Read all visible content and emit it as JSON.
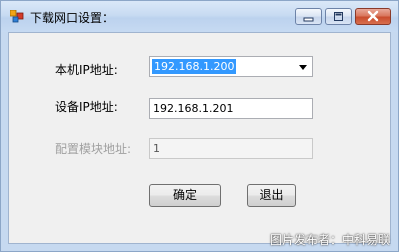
{
  "window": {
    "title": "下载网口设置："
  },
  "form": {
    "local_ip_label": "本机IP地址:",
    "local_ip_value": "192.168.1.200",
    "device_ip_label": "设备IP地址:",
    "device_ip_value": "192.168.1.201",
    "module_addr_label": "配置模块地址:",
    "module_addr_value": "1"
  },
  "buttons": {
    "ok_label": "确定",
    "exit_label": "退出"
  },
  "watermark": "图片发布者：中科易联",
  "colors": {
    "title_bar": "#c6daf2",
    "client_bg": "#f0f0f0",
    "selection": "#3399ff",
    "close_button": "#c94d2e"
  }
}
